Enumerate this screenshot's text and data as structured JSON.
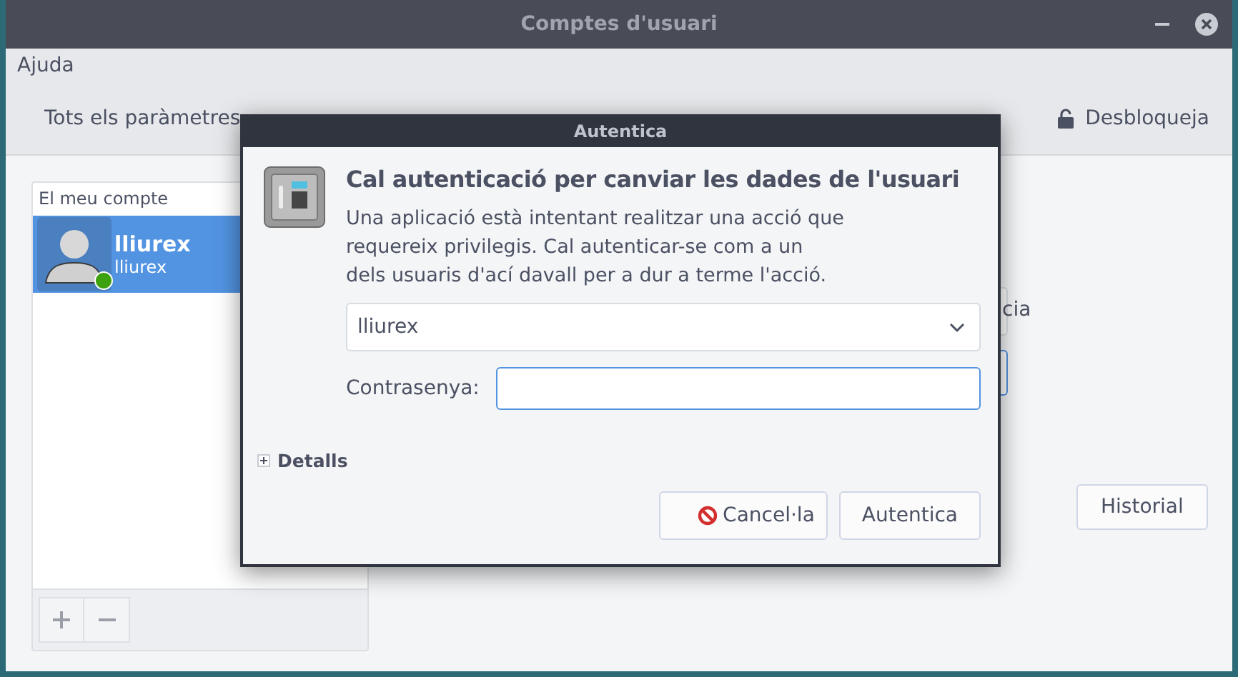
{
  "window": {
    "title": "Comptes d'usuari"
  },
  "menu": [
    "Ajuda"
  ],
  "header": {
    "breadcrumb": "Tots els paràmetres",
    "unlock_label": "Desbloqueja"
  },
  "accounts": {
    "heading": "El meu compte",
    "users": [
      {
        "name": "lliurex",
        "login": "lliurex",
        "online": true,
        "selected": true
      }
    ]
  },
  "behind_text": "cia",
  "history_button": "Historial",
  "dialog": {
    "title": "Autentica",
    "heading": "Cal autenticació per canviar les dades de l'usuari",
    "message": "Una aplicació està intentant realitzar una acció que\nrequereix privilegis. Cal autenticar-se com a un\ndels usuaris d'ací davall per a dur a terme l'acció.",
    "user_select": {
      "value": "lliurex"
    },
    "password": {
      "label": "Contrasenya:"
    },
    "details": {
      "label": "Detalls",
      "expanded": false
    },
    "buttons": [
      {
        "label": "Cancel·la",
        "kind": "cancel"
      },
      {
        "label": "Autentica",
        "kind": "default"
      }
    ]
  }
}
